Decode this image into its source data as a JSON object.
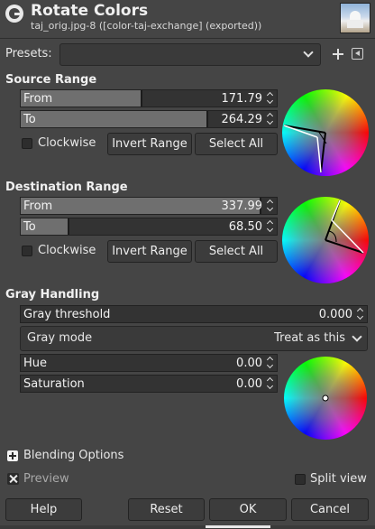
{
  "header": {
    "title": "Rotate Colors",
    "subtitle": "taj_orig.jpg-8 ([color-taj-exchange] (exported))",
    "app_icon": "gimp-icon",
    "thumbnail": "image-thumbnail"
  },
  "presets": {
    "label": "Presets:",
    "value": "",
    "add_icon": "plus-icon",
    "menu_icon": "menu-icon"
  },
  "source_range": {
    "heading": "Source Range",
    "from_label": "From",
    "from_value": "171.79",
    "from_fill": 0.477,
    "to_label": "To",
    "to_value": "264.29",
    "to_fill": 0.734,
    "clockwise_label": "Clockwise",
    "clockwise_checked": false,
    "invert_label": "Invert Range",
    "select_all_label": "Select All"
  },
  "destination_range": {
    "heading": "Destination Range",
    "from_label": "From",
    "from_value": "337.99",
    "from_fill": 0.939,
    "to_label": "To",
    "to_value": "68.50",
    "to_fill": 0.19,
    "clockwise_label": "Clockwise",
    "clockwise_checked": false,
    "invert_label": "Invert Range",
    "select_all_label": "Select All"
  },
  "gray_handling": {
    "heading": "Gray Handling",
    "threshold_label": "Gray threshold",
    "threshold_value": "0.000",
    "mode_label": "Gray mode",
    "mode_value": "Treat as this",
    "hue_label": "Hue",
    "hue_value": "0.00",
    "saturation_label": "Saturation",
    "saturation_value": "0.00"
  },
  "blending_options_label": "Blending Options",
  "preview_label": "Preview",
  "split_view_label": "Split view",
  "buttons": {
    "help": "Help",
    "reset": "Reset",
    "ok": "OK",
    "cancel": "Cancel"
  }
}
